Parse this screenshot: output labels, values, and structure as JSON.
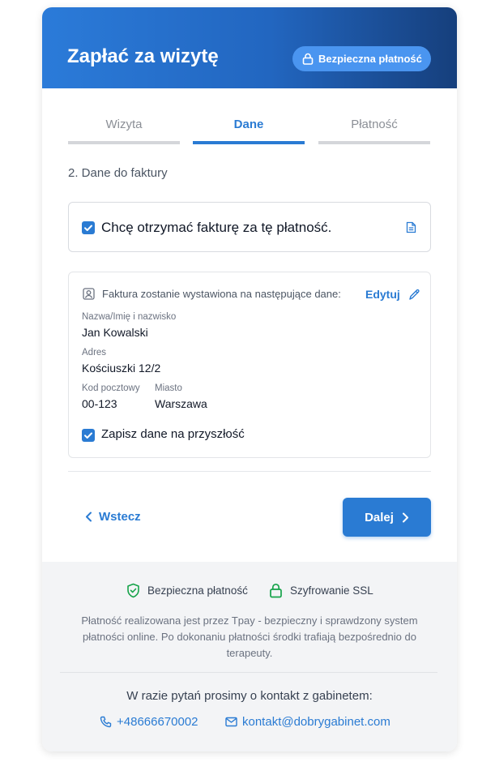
{
  "header": {
    "title": "Zapłać za wizytę",
    "secure_badge": "Bezpieczna płatność"
  },
  "steps": [
    {
      "label": "Wizyta",
      "active": false
    },
    {
      "label": "Dane",
      "active": true
    },
    {
      "label": "Płatność",
      "active": false
    }
  ],
  "section_title": "2. Dane do faktury",
  "invoice": {
    "checkbox_label": "Chcę otrzymać fakturę za tę płatność.",
    "checked": true
  },
  "billing": {
    "intro": "Faktura zostanie wystawiona na następujące dane:",
    "edit_label": "Edytuj",
    "name_label": "Nazwa/Imię i nazwisko",
    "name_value": "Jan Kowalski",
    "address_label": "Adres",
    "address_value": "Kościuszki 12/2",
    "postal_label": "Kod pocztowy",
    "postal_value": "00-123",
    "city_label": "Miasto",
    "city_value": "Warszawa",
    "save_label": "Zapisz dane na przyszłość",
    "save_checked": true
  },
  "nav": {
    "back_label": "Wstecz",
    "next_label": "Dalej"
  },
  "footer": {
    "badge_secure": "Bezpieczna płatność",
    "badge_ssl": "Szyfrowanie SSL",
    "description": "Płatność realizowana jest przez Tpay - bezpieczny i sprawdzony system płatności online. Po dokonaniu płatności środki trafiają bezpośrednio do terapeuty.",
    "contact_title": "W razie pytań prosimy o kontakt z gabinetem:",
    "phone": "+48666670002",
    "email": "kontakt@dobrygabinet.com"
  },
  "colors": {
    "accent": "#2a7bd3",
    "secure_green": "#16a34a"
  }
}
